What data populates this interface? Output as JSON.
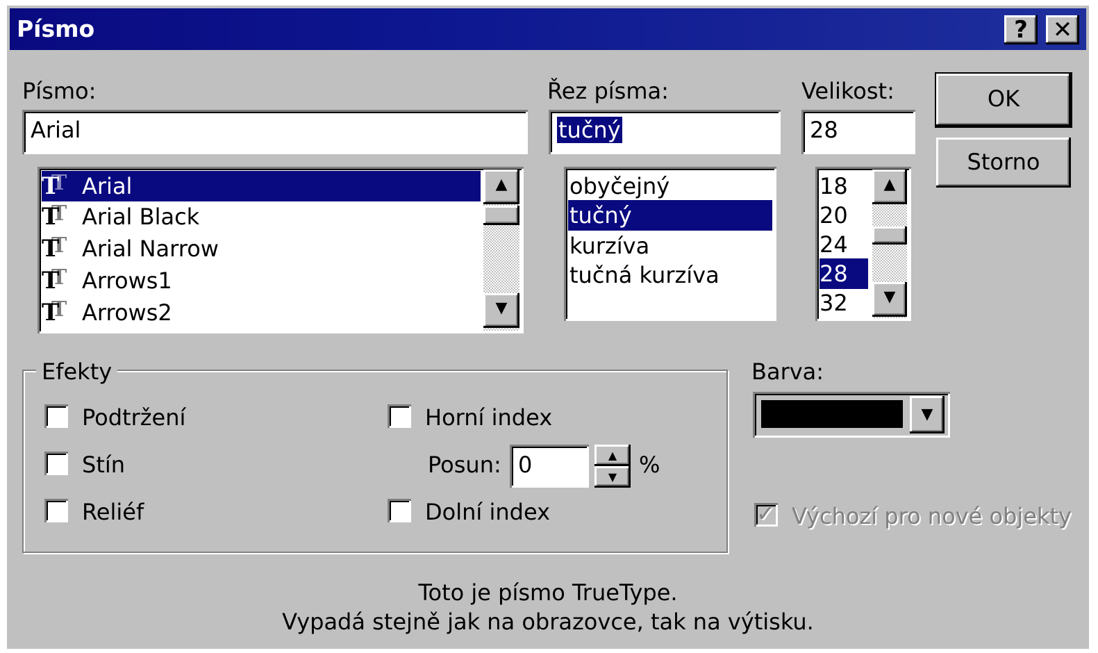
{
  "title": "Písmo",
  "titlebar": {
    "help": "?",
    "close": "✕"
  },
  "font": {
    "label": "Písmo:",
    "value": "Arial",
    "items": [
      "Arial",
      "Arial Black",
      "Arial Narrow",
      "Arrows1",
      "Arrows2"
    ],
    "selected_index": 0
  },
  "style": {
    "label": "Řez písma:",
    "value": "tučný",
    "items": [
      "obyčejný",
      "tučný",
      "kurzíva",
      "tučná kurzíva"
    ],
    "selected_index": 1
  },
  "size": {
    "label": "Velikost:",
    "value": "28",
    "items": [
      "18",
      "20",
      "24",
      "28",
      "32"
    ],
    "selected_index": 3
  },
  "buttons": {
    "ok": "OK",
    "cancel": "Storno"
  },
  "effects": {
    "legend": "Efekty",
    "underline": "Podtržení",
    "shadow": "Stín",
    "emboss": "Reliéf",
    "superscript": "Horní index",
    "offset_label": "Posun:",
    "offset_value": "0",
    "percent": "%",
    "subscript": "Dolní index"
  },
  "color": {
    "label": "Barva:",
    "value": "#000000"
  },
  "default_checkbox": {
    "label": "Výchozí pro nové objekty",
    "checked": true,
    "disabled": true
  },
  "info": {
    "line1": "Toto je písmo TrueType.",
    "line2": "Vypadá stejně jak na obrazovce, tak na výtisku."
  }
}
